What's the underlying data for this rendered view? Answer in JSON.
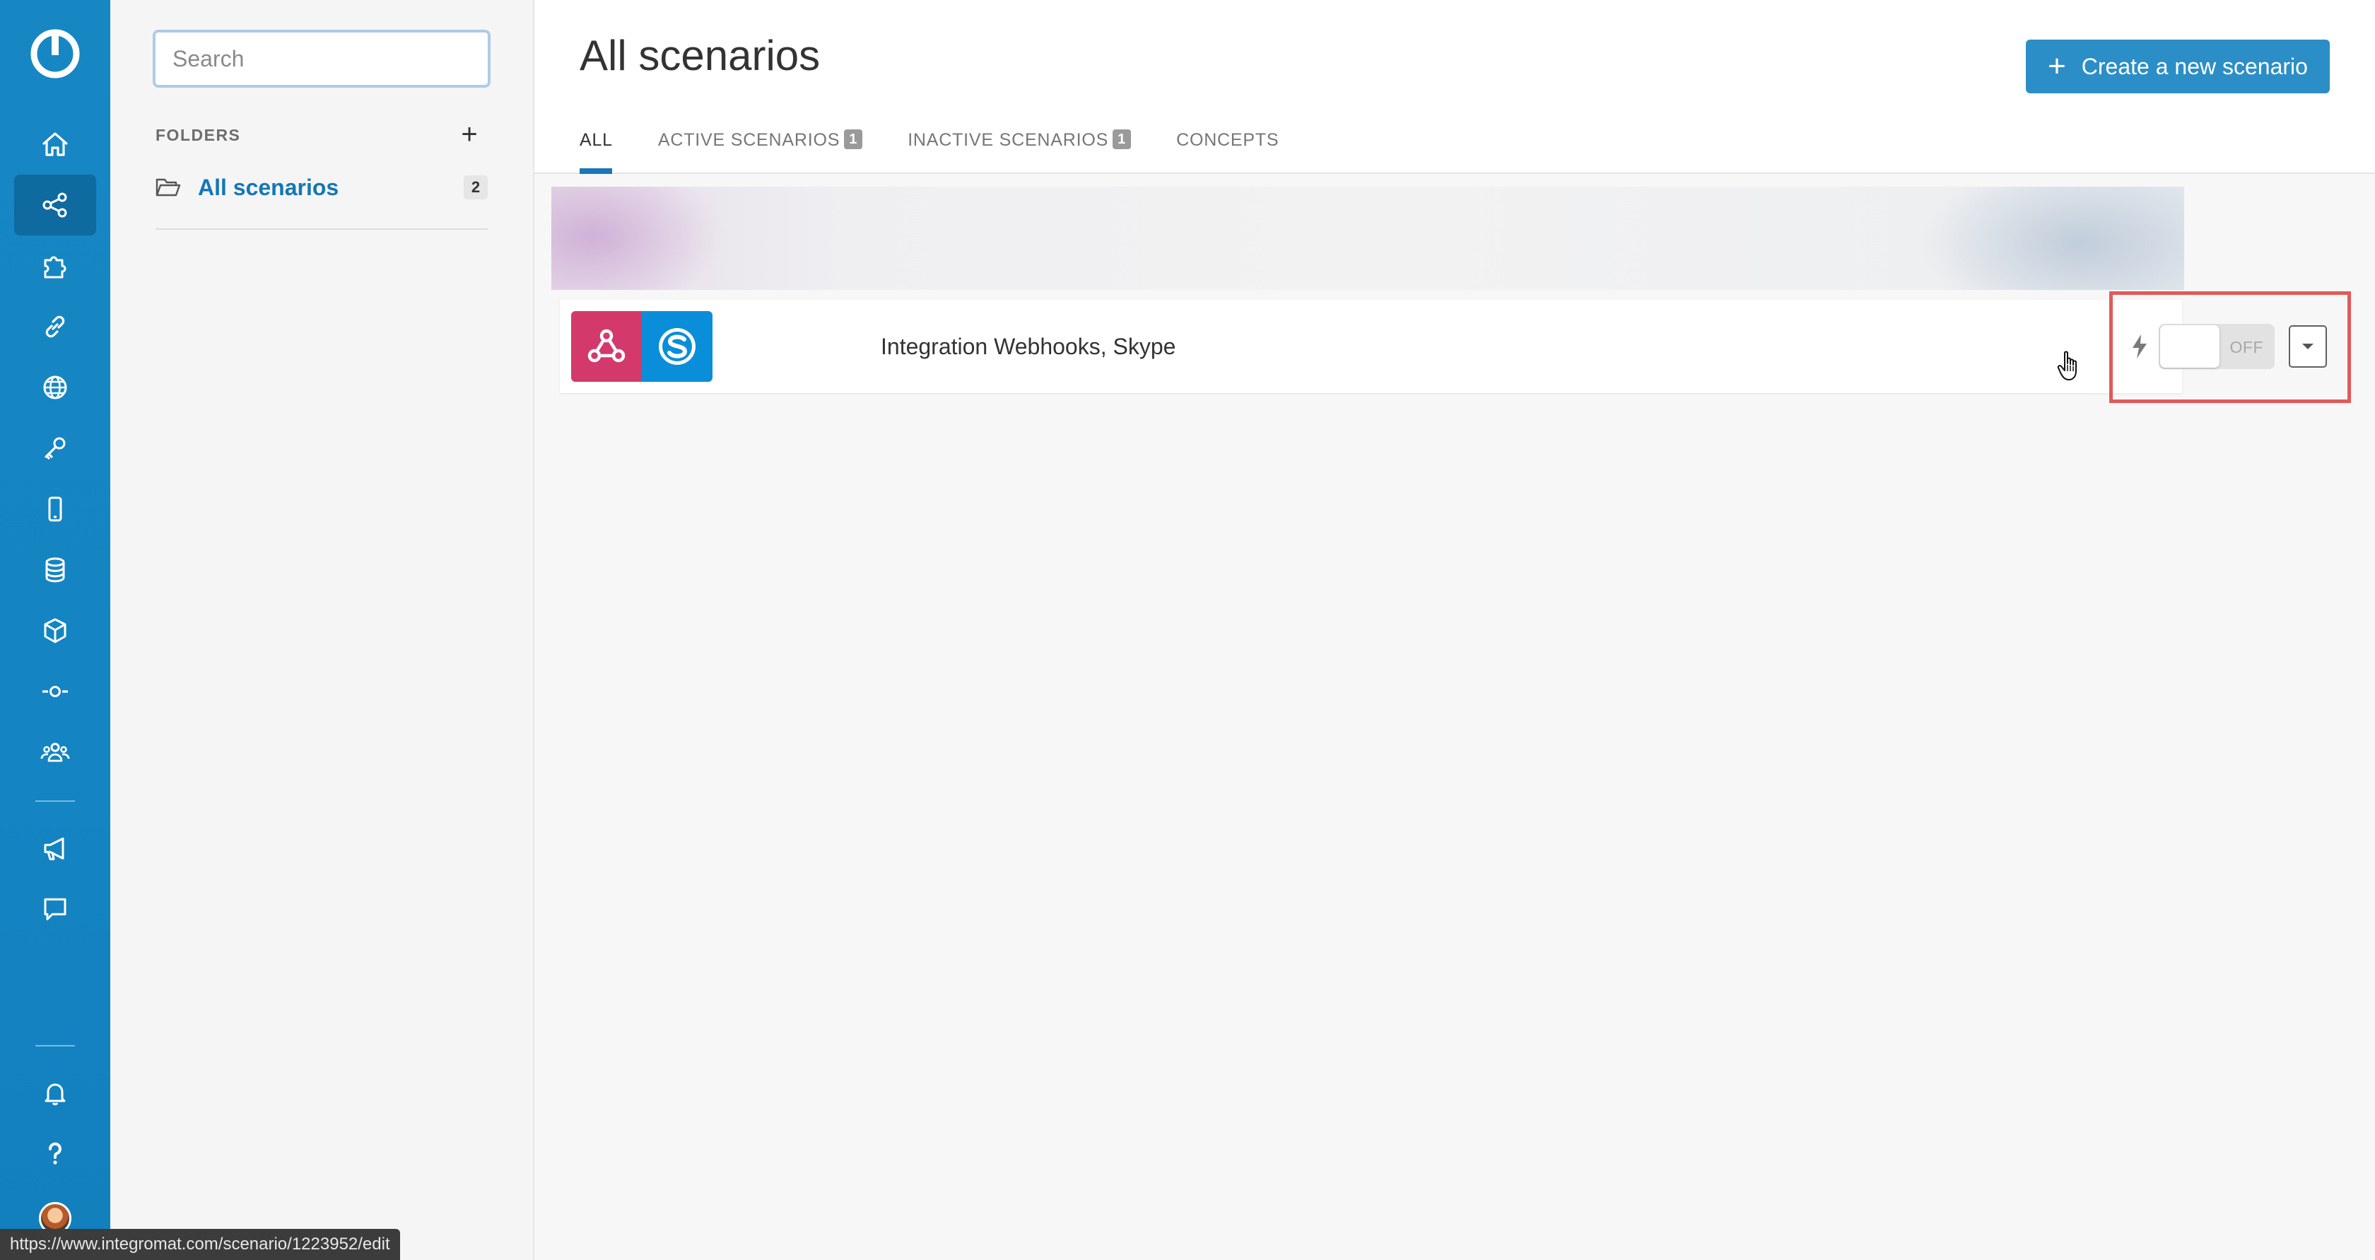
{
  "rail": {
    "items": [
      {
        "name": "home"
      },
      {
        "name": "scenarios",
        "active": true
      },
      {
        "name": "templates"
      },
      {
        "name": "connections"
      },
      {
        "name": "webhooks"
      },
      {
        "name": "keys"
      },
      {
        "name": "devices"
      },
      {
        "name": "data-stores"
      },
      {
        "name": "data-structures"
      },
      {
        "name": "apps"
      },
      {
        "name": "team"
      }
    ],
    "bottom_items": [
      {
        "name": "whats-new"
      },
      {
        "name": "feedback"
      },
      {
        "name": "notifications"
      },
      {
        "name": "help"
      }
    ]
  },
  "sidebar": {
    "search_placeholder": "Search",
    "folders_label": "FOLDERS",
    "add_folder_label": "+",
    "folders": [
      {
        "label": "All scenarios",
        "count": "2"
      }
    ]
  },
  "main": {
    "title": "All scenarios",
    "create_button": {
      "icon": "+",
      "label": "Create a new scenario"
    },
    "tabs": [
      {
        "label": "ALL",
        "badge": null,
        "active": true
      },
      {
        "label": "ACTIVE SCENARIOS",
        "badge": "1"
      },
      {
        "label": "INACTIVE SCENARIOS",
        "badge": "1"
      },
      {
        "label": "CONCEPTS",
        "badge": null
      }
    ],
    "scenarios": [
      {
        "name": "Integration Webhooks, Skype",
        "apps": [
          "webhooks-icon",
          "skype-icon"
        ],
        "toggle": {
          "state": "OFF"
        }
      }
    ]
  },
  "status_bar": {
    "url": "https://www.integromat.com/scenario/1223952/edit"
  },
  "colors": {
    "rail": "#1787c4",
    "accent": "#2c8ec7",
    "tab_indicator": "#1a76b7",
    "webhooks": "#d33a6b",
    "skype": "#0a8ed9",
    "highlight": "#e05a58"
  }
}
